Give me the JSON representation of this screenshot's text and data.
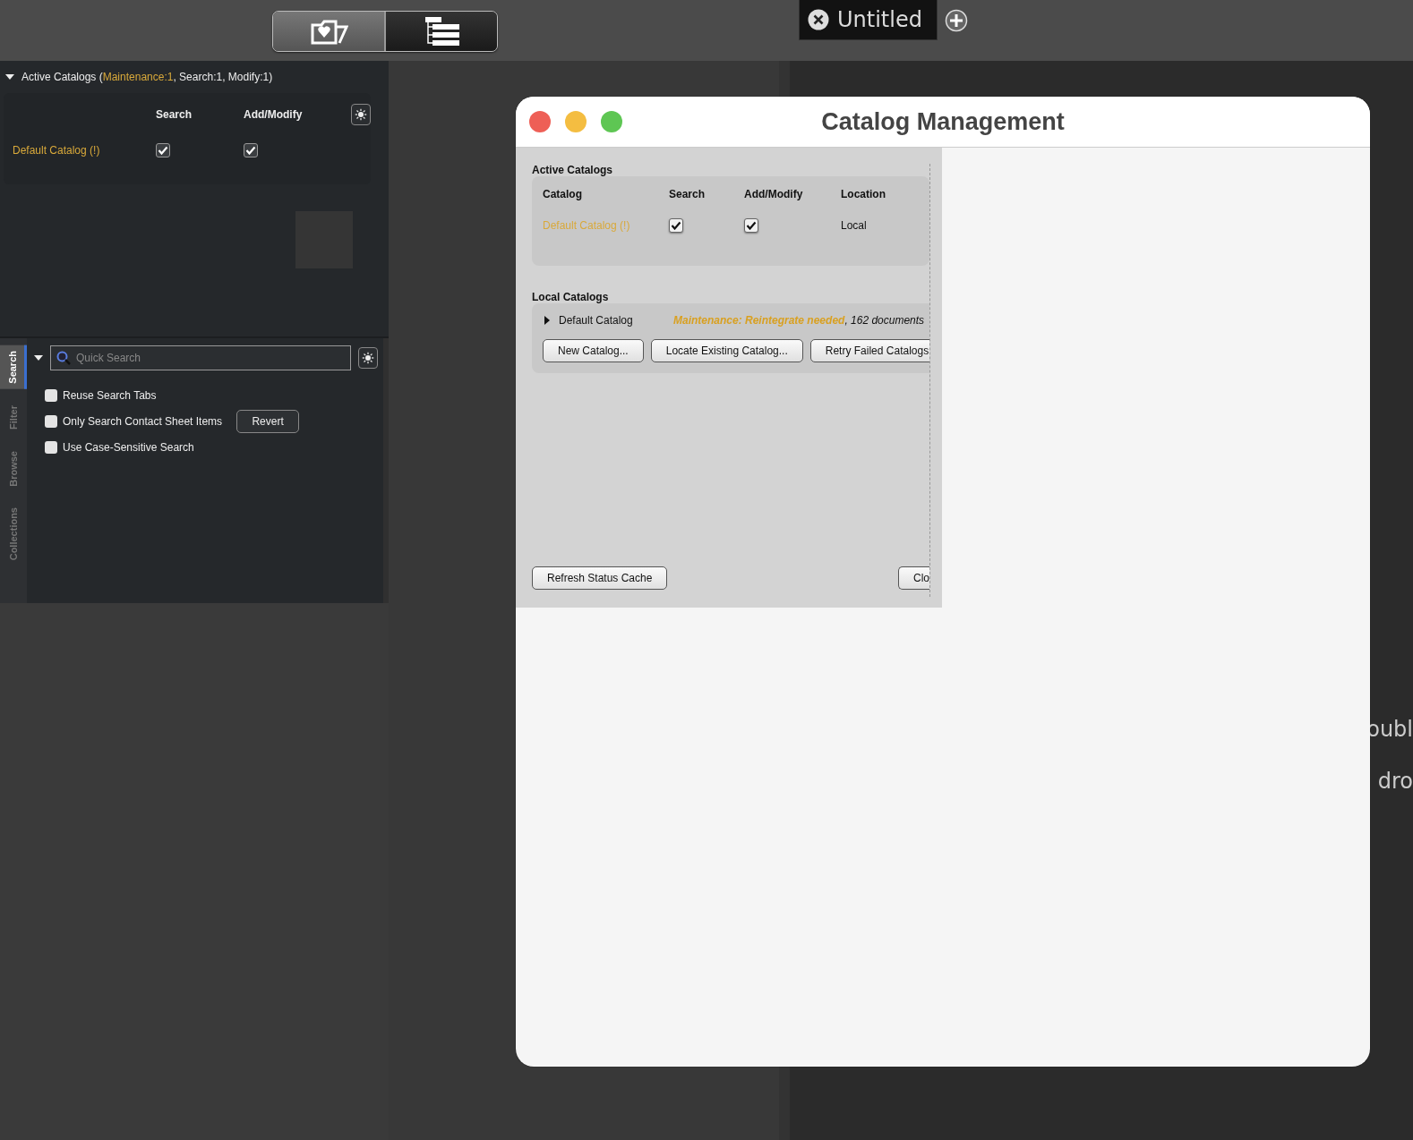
{
  "toolbar": {
    "view_buttons": [
      {
        "kind": "folder",
        "selected": false
      },
      {
        "kind": "outline",
        "selected": true
      }
    ],
    "document_tabs": [
      {
        "label": "Untitled",
        "selected": true
      }
    ]
  },
  "active_catalogs_panel": {
    "expanded": true,
    "title": [
      {
        "text": "Active Catalogs ("
      },
      {
        "text": "Maintenance:1",
        "warning": true
      },
      {
        "text": ", Search:1, Modify:1)"
      }
    ],
    "columns": [
      "Search",
      "Add/Modify"
    ],
    "rows": [
      {
        "name": "Default Catalog (!)",
        "warning": true,
        "search": true,
        "modify": true
      }
    ]
  },
  "side_tabs": [
    {
      "label": "Search",
      "selected": true
    },
    {
      "label": "Filter",
      "selected": false
    },
    {
      "label": "Browse",
      "selected": false
    },
    {
      "label": "Collections",
      "selected": false
    }
  ],
  "quick_search": {
    "placeholder": "Quick Search"
  },
  "options": [
    {
      "label": "Reuse Search Tabs",
      "checked": false
    },
    {
      "label": "Only Search Contact Sheet Items",
      "checked": false,
      "action": "Revert"
    },
    {
      "label": "Use Case-Sensitive Search",
      "checked": false
    }
  ],
  "dialog": {
    "title": "Catalog Management",
    "active_catalogs": {
      "label": "Active Catalogs",
      "columns": [
        "Catalog",
        "Search",
        "Add/Modify",
        "Location"
      ],
      "rows": [
        {
          "name": "Default Catalog (!)",
          "warning": true,
          "search": true,
          "modify": true,
          "location": "Local"
        }
      ]
    },
    "local_catalogs": {
      "label": "Local Catalogs",
      "items": [
        {
          "name": "Default Catalog",
          "expanded": false,
          "status": "Maintenance: Reintegrate needed",
          "details": ", 162 documents"
        }
      ],
      "buttons": [
        "New Catalog...",
        "Locate Existing Catalog...",
        "Retry Failed Catalogs"
      ]
    },
    "footer_buttons": [
      "Refresh Status Cache",
      "Clo"
    ]
  },
  "canvas_hints": [
    "oubl",
    "dro"
  ]
}
